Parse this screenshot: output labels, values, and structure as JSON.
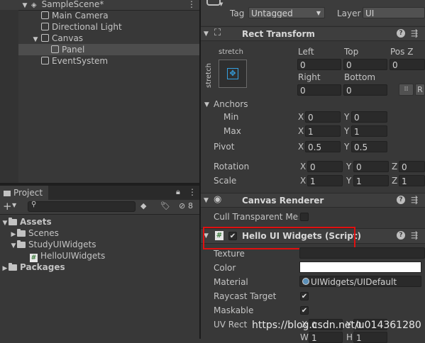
{
  "hierarchy": {
    "scene_name": "SampleScene*",
    "items": [
      {
        "label": "Main Camera"
      },
      {
        "label": "Directional Light"
      },
      {
        "label": "Canvas"
      },
      {
        "label": "Panel"
      },
      {
        "label": "EventSystem"
      }
    ]
  },
  "project": {
    "tab_label": "Project",
    "add_label": "+",
    "hidden_count": "8",
    "tree": [
      {
        "label": "Assets"
      },
      {
        "label": "Scenes"
      },
      {
        "label": "StudyUIWidgets"
      },
      {
        "label": "HelloUIWidgets"
      },
      {
        "label": "Packages"
      }
    ]
  },
  "inspector": {
    "tag_label": "Tag",
    "tag_value": "Untagged",
    "layer_label": "Layer",
    "layer_value": "UI",
    "rect_transform": {
      "title": "Rect Transform",
      "stretch_h": "stretch",
      "stretch_v": "stretch",
      "left_label": "Left",
      "left_value": "0",
      "top_label": "Top",
      "top_value": "0",
      "posz_label": "Pos Z",
      "posz_value": "0",
      "right_label": "Right",
      "right_value": "0",
      "bottom_label": "Bottom",
      "bottom_value": "0",
      "r_button": "R",
      "anchors_label": "Anchors",
      "min_label": "Min",
      "min_x": "0",
      "min_y": "0",
      "max_label": "Max",
      "max_x": "1",
      "max_y": "1",
      "pivot_label": "Pivot",
      "pivot_x": "0.5",
      "pivot_y": "0.5",
      "rotation_label": "Rotation",
      "rot_x": "0",
      "rot_y": "0",
      "rot_z": "0",
      "scale_label": "Scale",
      "scale_x": "1",
      "scale_y": "1",
      "scale_z": "1",
      "axis_x": "X",
      "axis_y": "Y",
      "axis_z": "Z"
    },
    "canvas_renderer": {
      "title": "Canvas Renderer",
      "cull_label": "Cull Transparent Mes"
    },
    "script": {
      "title": "Hello UI Widgets (Script)",
      "texture_label": "Texture",
      "color_label": "Color",
      "color_value": "#ffffff",
      "material_label": "Material",
      "material_value": "UIWidgets/UIDefault",
      "raycast_label": "Raycast Target",
      "maskable_label": "Maskable",
      "uvrect_label": "UV Rect",
      "uv_x": "0",
      "uv_y": "0",
      "uv_w": "1",
      "uv_h": "1",
      "axis_w": "W",
      "axis_h": "H"
    }
  },
  "watermark": "https://blog.csdn.net/u014361280",
  "colors": {
    "highlight_box": "#e01010",
    "selected_row": "#4d4d4d"
  }
}
